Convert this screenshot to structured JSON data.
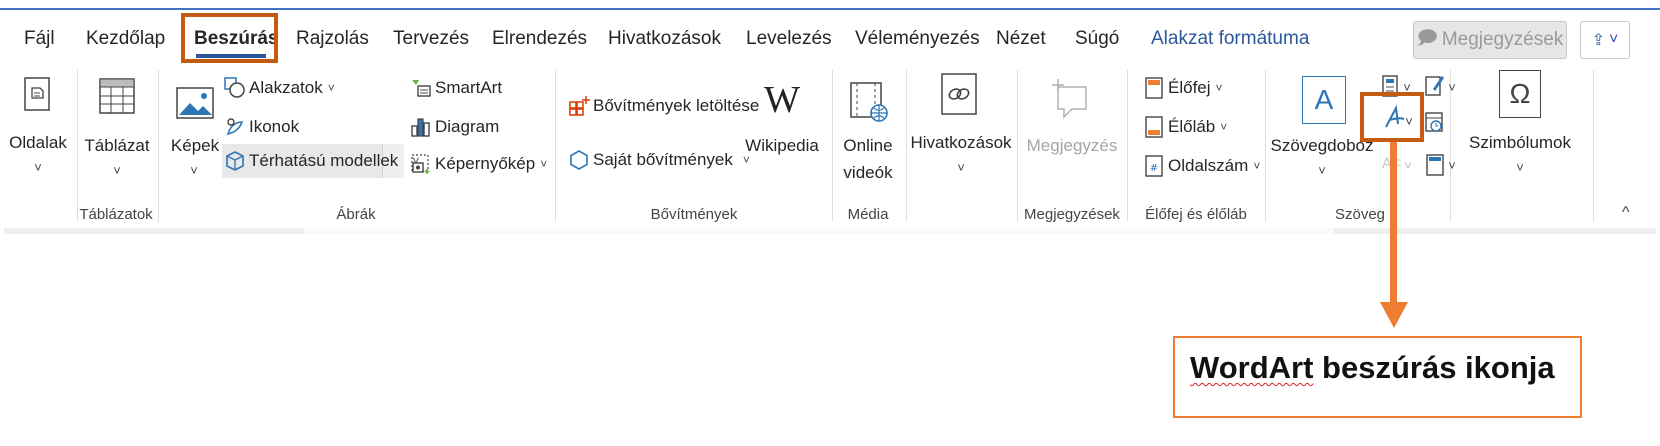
{
  "tabs": [
    "Fájl",
    "Kezdőlap",
    "Beszúrás",
    "Rajzolás",
    "Tervezés",
    "Elrendezés",
    "Hivatkozások",
    "Levelezés",
    "Véleményezés",
    "Nézet",
    "Súgó",
    "Alakzat formátuma"
  ],
  "active_tab": "Beszúrás",
  "header": {
    "comments_label": "Megjegyzések",
    "share_dropdown": "˅"
  },
  "ribbon": {
    "pages": {
      "label": "Oldalak"
    },
    "table": {
      "label": "Táblázat",
      "group": "Táblázatok"
    },
    "illustrations": {
      "pictures": "Képek",
      "shapes": "Alakzatok",
      "icons": "Ikonok",
      "models_3d": "Térhatású modellek",
      "smartart": "SmartArt",
      "chart": "Diagram",
      "screenshot": "Képernyőkép",
      "group": "Ábrák"
    },
    "addins": {
      "get_addins": "Bővítmények letöltése",
      "my_addins": "Saját bővítmények",
      "wikipedia": "Wikipedia",
      "wikipedia_glyph": "W",
      "group": "Bővítmények"
    },
    "media": {
      "line1": "Online",
      "line2": "videók",
      "group": "Média"
    },
    "links": {
      "label": "Hivatkozások"
    },
    "comments": {
      "label": "Megjegyzés",
      "group": "Megjegyzések"
    },
    "header_footer": {
      "header": "Élőfej",
      "footer": "Élőláb",
      "page_number": "Oldalszám",
      "group": "Élőfej és élőláb"
    },
    "text": {
      "textbox": "Szövegdoboz",
      "textbox_glyph": "A",
      "group": "Szöveg"
    },
    "symbols": {
      "label": "Szimbólumok",
      "glyph": "Ω"
    },
    "chevron": "˅",
    "collapse": "^"
  },
  "callout": {
    "word1": "WordArt",
    "rest": " beszúrás ikonja"
  },
  "colors": {
    "accent": "#2b579a",
    "highlight": "#c55a11",
    "arrow": "#ed7d31"
  }
}
